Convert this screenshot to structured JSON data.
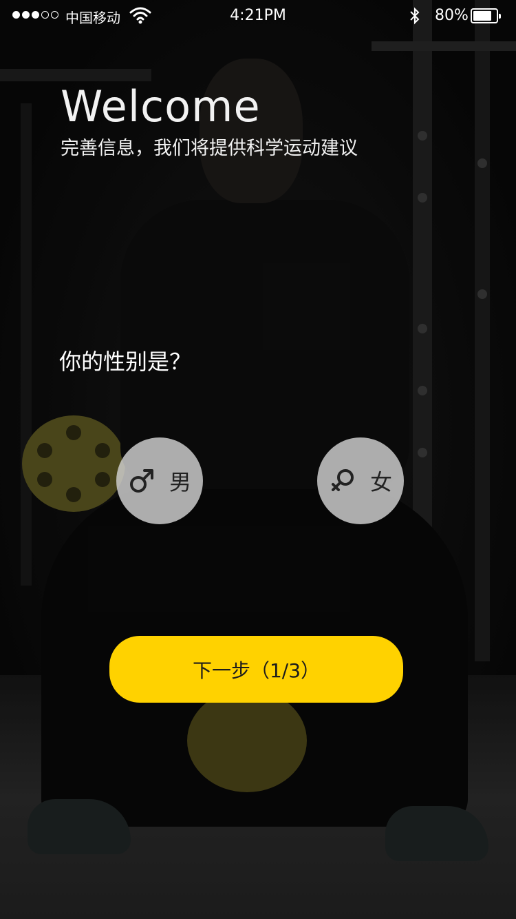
{
  "status_bar": {
    "signal_dots_filled": 3,
    "signal_dots_total": 5,
    "carrier": "中国移动",
    "time": "4:21PM",
    "bluetooth_icon": "bluetooth-icon",
    "battery_percent": "80%",
    "battery_level": 0.8
  },
  "header": {
    "title": "Welcome",
    "subtitle": "完善信息，我们将提供科学运动建议"
  },
  "question": {
    "label": "你的性别是？"
  },
  "gender_options": [
    {
      "label": "男",
      "icon": "male-icon"
    },
    {
      "label": "女",
      "icon": "female-icon"
    }
  ],
  "next_button": {
    "label": "下一步（1/3）"
  },
  "colors": {
    "accent": "#ffd200",
    "option_bg": "#d2d2d2",
    "text": "#ffffff"
  }
}
